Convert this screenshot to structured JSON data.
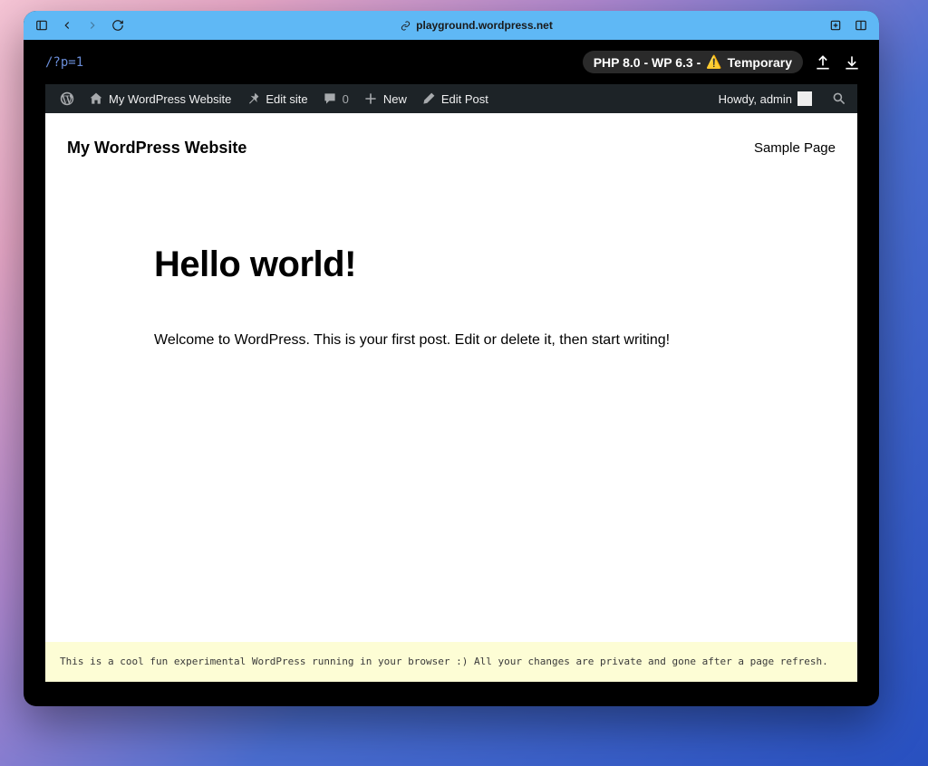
{
  "browser": {
    "url": "playground.wordpress.net"
  },
  "playground": {
    "path": "/?p=1",
    "version_prefix": "PHP 8.0 - WP 6.3 -",
    "version_suffix": "Temporary"
  },
  "adminbar": {
    "site_name": "My WordPress Website",
    "edit_site": "Edit site",
    "comments_count": "0",
    "new_label": "New",
    "edit_post": "Edit Post",
    "greeting": "Howdy, admin"
  },
  "page": {
    "site_title": "My WordPress Website",
    "nav_link": "Sample Page",
    "post_title": "Hello world!",
    "post_body": "Welcome to WordPress. This is your first post. Edit or delete it, then start writing!"
  },
  "footer": {
    "notice": "This is a cool fun experimental WordPress running in your browser :) All your changes are private and gone after a page refresh."
  }
}
